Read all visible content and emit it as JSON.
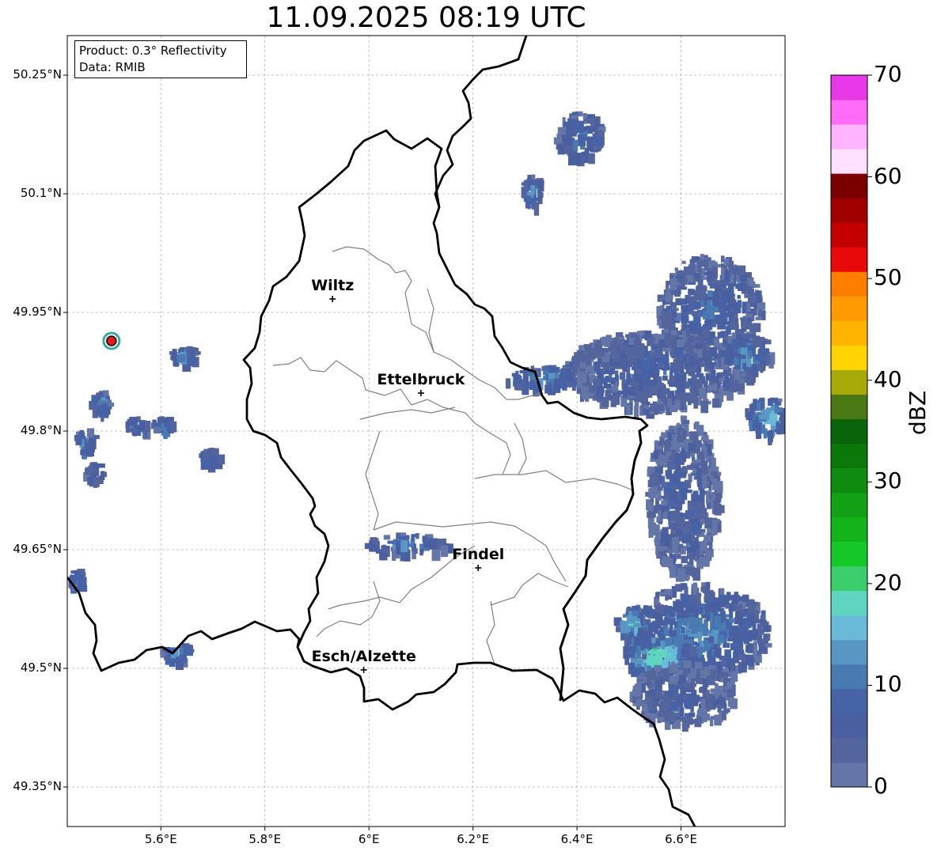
{
  "title": "11.09.2025 08:19 UTC",
  "info": {
    "product": "Product: 0.3° Reflectivity",
    "data": "Data: RMIB"
  },
  "map_view": {
    "lon_range": [
      5.42,
      6.8
    ],
    "lat_range": [
      49.3,
      50.3
    ]
  },
  "axes": {
    "y_ticks": [
      {
        "value": 50.25,
        "label": "50.25°N"
      },
      {
        "value": 50.1,
        "label": "50.1°N"
      },
      {
        "value": 49.95,
        "label": "49.95°N"
      },
      {
        "value": 49.8,
        "label": "49.8°N"
      },
      {
        "value": 49.65,
        "label": "49.65°N"
      },
      {
        "value": 49.5,
        "label": "49.5°N"
      },
      {
        "value": 49.35,
        "label": "49.35°N"
      }
    ],
    "x_ticks": [
      {
        "value": 5.6,
        "label": "5.6°E"
      },
      {
        "value": 5.8,
        "label": "5.8°E"
      },
      {
        "value": 6.0,
        "label": "6°E"
      },
      {
        "value": 6.2,
        "label": "6.2°E"
      },
      {
        "value": 6.4,
        "label": "6.4°E"
      },
      {
        "value": 6.6,
        "label": "6.6°E"
      }
    ]
  },
  "cities": [
    {
      "name": "Wiltz",
      "lon": 5.93,
      "lat": 49.967
    },
    {
      "name": "Ettelbruck",
      "lon": 6.1,
      "lat": 49.848
    },
    {
      "name": "Findel",
      "lon": 6.21,
      "lat": 49.627
    },
    {
      "name": "Esch/Alzette",
      "lon": 5.99,
      "lat": 49.498
    }
  ],
  "radar_site": {
    "lon": 5.505,
    "lat": 49.914
  },
  "colorbar": {
    "label": "dBZ",
    "min": 0,
    "max": 70,
    "ticks": [
      "0",
      "10",
      "20",
      "30",
      "40",
      "50",
      "60",
      "70"
    ],
    "colors": [
      "#6475a8",
      "#54649c",
      "#4a5fa0",
      "#4563a6",
      "#4a7ab2",
      "#5a96c4",
      "#68bad8",
      "#5fd4c0",
      "#3ccd6c",
      "#14c828",
      "#12b41a",
      "#12a014",
      "#0f8c10",
      "#0c780c",
      "#0a640a",
      "#4a7814",
      "#a8aa0a",
      "#ffd400",
      "#ffb400",
      "#ff9a00",
      "#ff7e00",
      "#e80a0a",
      "#c40000",
      "#a00000",
      "#7a0000",
      "#ffe0ff",
      "#ffb4ff",
      "#ff6cf8",
      "#e838e8"
    ]
  },
  "echoes": [
    {
      "lon": 6.4,
      "lat": 50.175,
      "rlon": 0.045,
      "rlat": 0.03,
      "intensity": 12
    },
    {
      "lon": 6.31,
      "lat": 50.105,
      "rlon": 0.02,
      "rlat": 0.02,
      "intensity": 14
    },
    {
      "lon": 6.65,
      "lat": 49.955,
      "rlon": 0.1,
      "rlat": 0.07,
      "intensity": 9
    },
    {
      "lon": 6.55,
      "lat": 49.88,
      "rlon": 0.18,
      "rlat": 0.05,
      "intensity": 8
    },
    {
      "lon": 6.33,
      "lat": 49.87,
      "rlon": 0.07,
      "rlat": 0.015,
      "intensity": 15
    },
    {
      "lon": 6.72,
      "lat": 49.9,
      "rlon": 0.05,
      "rlat": 0.025,
      "intensity": 14
    },
    {
      "lon": 6.76,
      "lat": 49.82,
      "rlon": 0.04,
      "rlat": 0.025,
      "intensity": 18
    },
    {
      "lon": 6.6,
      "lat": 49.72,
      "rlon": 0.07,
      "rlat": 0.1,
      "intensity": 7
    },
    {
      "lon": 6.63,
      "lat": 49.55,
      "rlon": 0.14,
      "rlat": 0.06,
      "intensity": 13
    },
    {
      "lon": 6.55,
      "lat": 49.52,
      "rlon": 0.07,
      "rlat": 0.025,
      "intensity": 22
    },
    {
      "lon": 6.5,
      "lat": 49.56,
      "rlon": 0.03,
      "rlat": 0.02,
      "intensity": 20
    },
    {
      "lon": 6.6,
      "lat": 49.47,
      "rlon": 0.1,
      "rlat": 0.04,
      "intensity": 7
    },
    {
      "lon": 6.07,
      "lat": 49.66,
      "rlon": 0.08,
      "rlat": 0.012,
      "intensity": 14
    },
    {
      "lon": 5.625,
      "lat": 49.523,
      "rlon": 0.03,
      "rlat": 0.012,
      "intensity": 14
    },
    {
      "lon": 5.64,
      "lat": 49.9,
      "rlon": 0.025,
      "rlat": 0.01,
      "intensity": 14
    },
    {
      "lon": 5.55,
      "lat": 49.81,
      "rlon": 0.02,
      "rlat": 0.01,
      "intensity": 13
    },
    {
      "lon": 5.6,
      "lat": 49.81,
      "rlon": 0.02,
      "rlat": 0.01,
      "intensity": 15
    },
    {
      "lon": 5.69,
      "lat": 49.77,
      "rlon": 0.02,
      "rlat": 0.01,
      "intensity": 14
    },
    {
      "lon": 5.45,
      "lat": 49.79,
      "rlon": 0.02,
      "rlat": 0.015,
      "intensity": 15
    },
    {
      "lon": 5.48,
      "lat": 49.84,
      "rlon": 0.02,
      "rlat": 0.015,
      "intensity": 12
    },
    {
      "lon": 5.47,
      "lat": 49.75,
      "rlon": 0.02,
      "rlat": 0.012,
      "intensity": 12
    },
    {
      "lon": 5.435,
      "lat": 49.615,
      "rlon": 0.015,
      "rlat": 0.012,
      "intensity": 12
    }
  ]
}
